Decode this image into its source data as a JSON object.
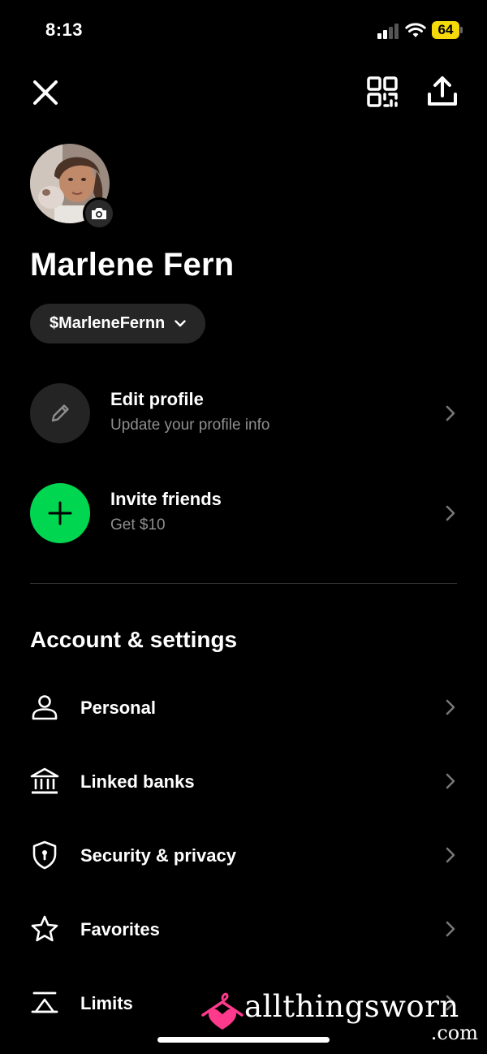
{
  "status_bar": {
    "time": "8:13",
    "battery": "64",
    "battery_color": "#f5d90a"
  },
  "header": {
    "close_icon": "close-icon",
    "qr_icon": "qr-code-icon",
    "share_icon": "share-upload-icon"
  },
  "profile": {
    "name": "Marlene Fern",
    "cashtag": "$MarleneFernn",
    "avatar_icon": "avatar-photo",
    "camera_icon": "camera-icon"
  },
  "actions": [
    {
      "title": "Edit profile",
      "subtitle": "Update your profile info",
      "icon": "pencil-icon",
      "color": "#242424"
    },
    {
      "title": "Invite friends",
      "subtitle": "Get $10",
      "icon": "plus-icon",
      "color": "#00d64f"
    }
  ],
  "section": {
    "title": "Account & settings"
  },
  "settings": [
    {
      "label": "Personal",
      "icon": "person-icon"
    },
    {
      "label": "Linked banks",
      "icon": "bank-icon"
    },
    {
      "label": "Security & privacy",
      "icon": "shield-icon"
    },
    {
      "label": "Favorites",
      "icon": "star-icon"
    },
    {
      "label": "Limits",
      "icon": "limits-icon"
    }
  ],
  "watermark": {
    "text": "allthingsworn",
    "suffix": ".com",
    "accent": "#ff3a8c"
  }
}
